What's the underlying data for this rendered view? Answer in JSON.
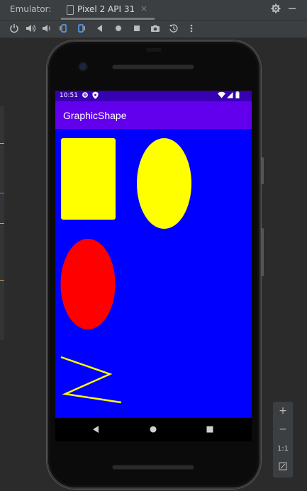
{
  "ide": {
    "emulator_label": "Emulator:",
    "tab_name": "Pixel 2 API 31",
    "tab_close": "×",
    "settings_icon": "gear-icon",
    "minimize_icon": "minus-icon"
  },
  "toolbar": {
    "buttons": [
      "power-icon",
      "volume-up-icon",
      "volume-down-icon",
      "rotate-left-icon",
      "rotate-right-icon",
      "back-icon",
      "home-icon",
      "overview-icon",
      "camera-icon",
      "snapshot-icon",
      "more-icon"
    ]
  },
  "device": {
    "status": {
      "time": "10:51"
    },
    "app_title": "GraphicShape",
    "colors": {
      "background": "#0000ff",
      "appbar": "#6200ee",
      "statusbar": "#3700b3",
      "yellow": "#ffff00",
      "red": "#ff0000"
    }
  },
  "zoom": {
    "zoom_in": "+",
    "zoom_out": "−",
    "one_to_one": "1:1"
  }
}
